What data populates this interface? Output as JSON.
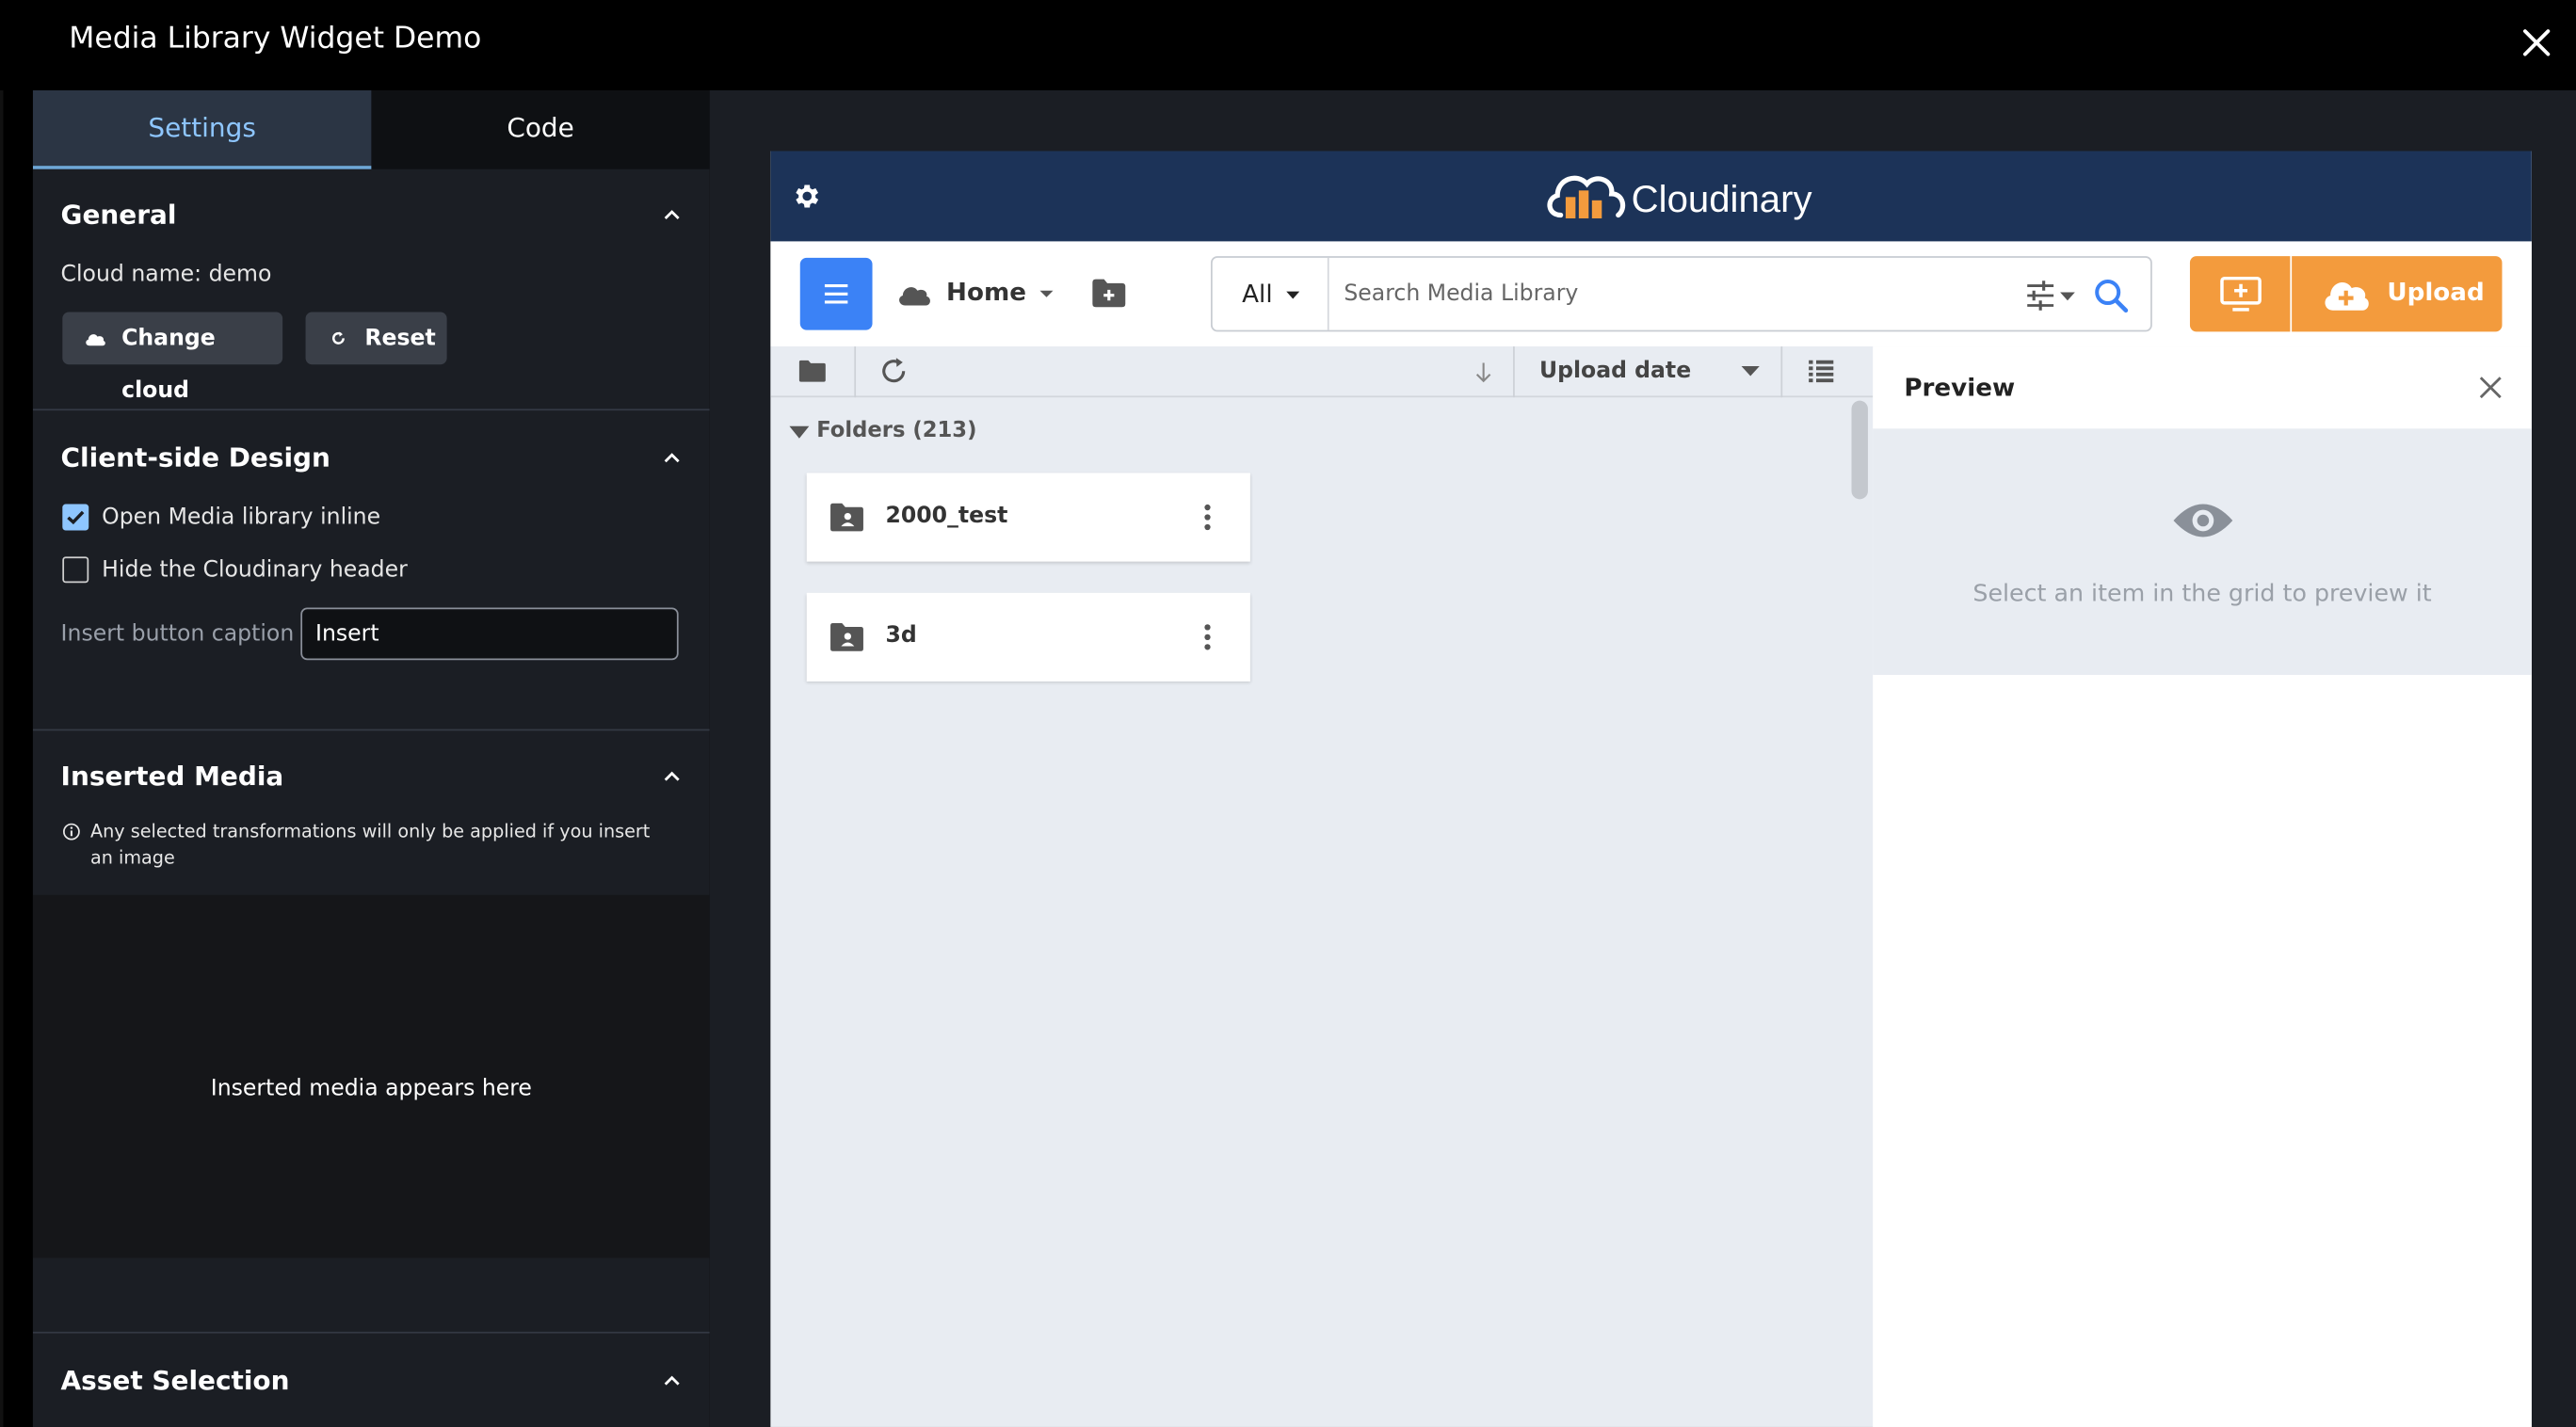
{
  "window": {
    "title": "Media Library Widget Demo"
  },
  "tabs": [
    {
      "label": "Settings"
    },
    {
      "label": "Code"
    }
  ],
  "general": {
    "title": "General",
    "cloud_name": "Cloud name: demo",
    "change_cloud_label": "Change cloud",
    "reset_label": "Reset"
  },
  "client_design": {
    "title": "Client-side Design",
    "open_inline_label": "Open Media library inline",
    "open_inline_checked": true,
    "hide_header_label": "Hide the Cloudinary header",
    "hide_header_checked": false,
    "insert_caption_label": "Insert button caption",
    "insert_caption_value": "Insert"
  },
  "inserted_media": {
    "title": "Inserted Media",
    "note": "Any selected transformations will only be applied if you insert an image",
    "empty_text": "Inserted media appears here"
  },
  "asset_selection": {
    "title": "Asset Selection"
  },
  "widget": {
    "brand": "Cloudinary",
    "home_label": "Home",
    "search_scope": "All",
    "search_placeholder": "Search Media Library",
    "upload_label": "Upload",
    "sort_label": "Upload date",
    "folders_label": "Folders (213)",
    "folders": [
      {
        "name": "2000_test"
      },
      {
        "name": "3d"
      }
    ],
    "preview_title": "Preview",
    "preview_message": "Select an item in the grid to preview it"
  },
  "colors": {
    "accent_blue": "#3b82f6",
    "upload_orange": "#f39b3d",
    "header_navy": "#1c3358",
    "tab_active_text": "#8ec6ff"
  },
  "icons": [
    "close-icon",
    "chevron-up-icon",
    "cloud-icon",
    "refresh-icon",
    "info-icon",
    "gear-icon",
    "menu-icon",
    "chevron-down-icon",
    "new-folder-icon",
    "filter-icon",
    "search-icon",
    "media-icon",
    "upload-cloud-icon",
    "folder-icon",
    "sort-arrow-icon",
    "list-view-icon",
    "shared-folder-icon",
    "more-vertical-icon",
    "eye-icon"
  ]
}
